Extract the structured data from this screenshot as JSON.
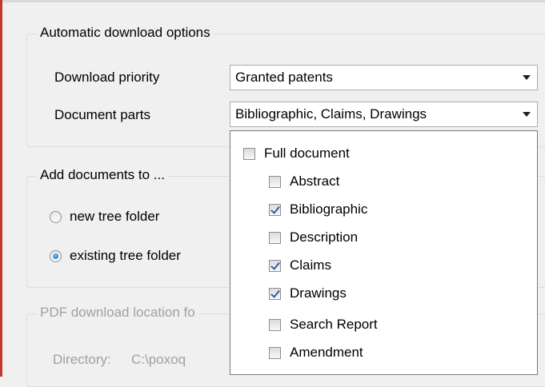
{
  "auto_download": {
    "title": "Automatic download options",
    "priority_label": "Download priority",
    "priority_value": "Granted patents",
    "parts_label": "Document parts",
    "parts_value": "Bibliographic, Claims, Drawings"
  },
  "add_documents": {
    "title": "Add documents to ...",
    "options": [
      {
        "label": "new tree folder",
        "selected": false
      },
      {
        "label": "existing tree folder",
        "selected": true
      }
    ]
  },
  "pdf_location": {
    "title": "PDF download location fo",
    "directory_label": "Directory:",
    "directory_value": "C:\\poxoq"
  },
  "parts_dropdown": {
    "items": [
      {
        "label": "Full document",
        "checked": false,
        "indent": 0
      },
      {
        "label": "Abstract",
        "checked": false,
        "indent": 1
      },
      {
        "label": "Bibliographic",
        "checked": true,
        "indent": 1
      },
      {
        "label": "Description",
        "checked": false,
        "indent": 1
      },
      {
        "label": "Claims",
        "checked": true,
        "indent": 1
      },
      {
        "label": "Drawings",
        "checked": true,
        "indent": 1
      },
      {
        "label": "Search Report",
        "checked": false,
        "indent": 1
      },
      {
        "label": "Amendment",
        "checked": false,
        "indent": 1
      }
    ]
  }
}
